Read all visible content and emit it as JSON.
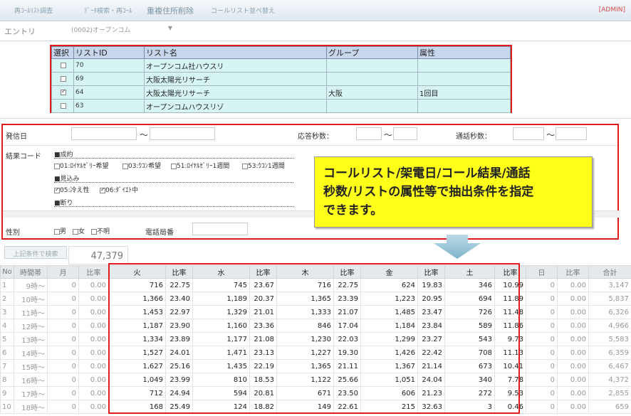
{
  "nav": {
    "tabs": [
      "再ｺｰﾙﾘｽﾄ調査",
      "ﾃﾞｰﾀ検索・再ｺｰﾙ",
      "重複住所削除",
      "コールリスト並べ替え"
    ],
    "admin": "[ADMIN]"
  },
  "entry": {
    "label": "エントリ",
    "value": "(0002)オープンコム"
  },
  "list": {
    "headers": [
      "選択",
      "リストID",
      "リスト名",
      "グループ",
      "属性"
    ],
    "rows": [
      {
        "checked": false,
        "id": "70",
        "name": "オープンコム社ハウスリ",
        "group": "",
        "attr": ""
      },
      {
        "checked": false,
        "id": "69",
        "name": "大阪太陽光リサーチ",
        "group": "",
        "attr": ""
      },
      {
        "checked": true,
        "id": "64",
        "name": "大阪太陽光リサーチ",
        "group": "大阪",
        "attr": "1回目"
      },
      {
        "checked": false,
        "id": "63",
        "name": "オープンコムハウスリゾ",
        "group": "",
        "attr": ""
      }
    ]
  },
  "filter": {
    "call_date_label": "発信日",
    "answer_sec_label": "応答秒数：",
    "talk_sec_label": "通話秒数：",
    "tilde": "～",
    "result_code_label": "結果コード",
    "groups": [
      {
        "title": "■成約",
        "options": [
          {
            "label": "01:ﾛｲﾔﾙｾﾞﾘｰ希望",
            "checked": false
          },
          {
            "label": "03:ｳｺﾝ希望",
            "checked": false
          },
          {
            "label": "51:ﾛｲﾔﾙｾﾞﾘｰ1週間",
            "checked": false
          },
          {
            "label": "53:ｳｺﾝ1週間",
            "checked": false
          }
        ]
      },
      {
        "title": "■見込み",
        "options": [
          {
            "label": "05:冷え性",
            "checked": true
          },
          {
            "label": "06:ﾀﾞｲｴﾄ中",
            "checked": true
          }
        ]
      },
      {
        "title": "■断り",
        "options": []
      }
    ],
    "gender_label": "性別",
    "gender_options": [
      {
        "label": "男",
        "checked": false
      },
      {
        "label": "女",
        "checked": false
      },
      {
        "label": "不明",
        "checked": false
      }
    ],
    "phone_office_label": "電話局番"
  },
  "callout": {
    "line1": "コールリスト/架電日/コール結果/通話",
    "line2": "秒数/リストの属性等で抽出条件を指定",
    "line3": "できます。"
  },
  "search": {
    "button": "上記条件で検索",
    "count": "47,379"
  },
  "result": {
    "headers": [
      "No",
      "時間帯",
      "月",
      "比率",
      "火",
      "比率",
      "水",
      "比率",
      "木",
      "比率",
      "金",
      "比率",
      "土",
      "比率",
      "日",
      "比率",
      "合計"
    ],
    "rows": [
      [
        "1",
        "9時～",
        "0",
        "0.00",
        "716",
        "22.75",
        "745",
        "23.67",
        "716",
        "22.75",
        "624",
        "19.83",
        "346",
        "10.99",
        "0",
        "0.00",
        "3,147"
      ],
      [
        "2",
        "10時～",
        "0",
        "0.00",
        "1,366",
        "23.40",
        "1,189",
        "20.37",
        "1,365",
        "23.39",
        "1,223",
        "20.95",
        "694",
        "11.89",
        "0",
        "0.00",
        "5,837"
      ],
      [
        "3",
        "11時～",
        "0",
        "0.00",
        "1,453",
        "22.97",
        "1,329",
        "21.01",
        "1,333",
        "21.07",
        "1,485",
        "23.47",
        "726",
        "11.48",
        "0",
        "0.00",
        "6,326"
      ],
      [
        "4",
        "12時～",
        "0",
        "0.00",
        "1,187",
        "23.90",
        "1,160",
        "23.36",
        "846",
        "17.04",
        "1,184",
        "23.84",
        "589",
        "11.86",
        "0",
        "0.00",
        "4,966"
      ],
      [
        "5",
        "13時～",
        "0",
        "0.00",
        "1,334",
        "23.89",
        "1,177",
        "21.08",
        "1,230",
        "22.03",
        "1,299",
        "23.27",
        "543",
        "9.73",
        "0",
        "0.00",
        "5,583"
      ],
      [
        "6",
        "14時～",
        "0",
        "0.00",
        "1,527",
        "24.01",
        "1,471",
        "23.13",
        "1,227",
        "19.30",
        "1,426",
        "22.42",
        "708",
        "11.13",
        "0",
        "0.00",
        "6,359"
      ],
      [
        "7",
        "15時～",
        "0",
        "0.00",
        "1,627",
        "25.16",
        "1,435",
        "22.19",
        "1,365",
        "21.11",
        "1,367",
        "21.14",
        "673",
        "10.41",
        "0",
        "0.00",
        "6,467"
      ],
      [
        "8",
        "16時～",
        "0",
        "0.00",
        "1,049",
        "23.99",
        "810",
        "18.53",
        "1,122",
        "25.66",
        "1,051",
        "24.04",
        "340",
        "7.78",
        "0",
        "0.00",
        "4,372"
      ],
      [
        "9",
        "17時～",
        "0",
        "0.00",
        "712",
        "24.94",
        "594",
        "20.81",
        "671",
        "23.50",
        "606",
        "21.23",
        "272",
        "9.53",
        "0",
        "0.00",
        "2,855"
      ],
      [
        "10",
        "18時～",
        "0",
        "0.00",
        "168",
        "25.49",
        "124",
        "18.82",
        "149",
        "22.61",
        "215",
        "32.63",
        "3",
        "0.46",
        "0",
        "0.00",
        "659"
      ]
    ]
  }
}
